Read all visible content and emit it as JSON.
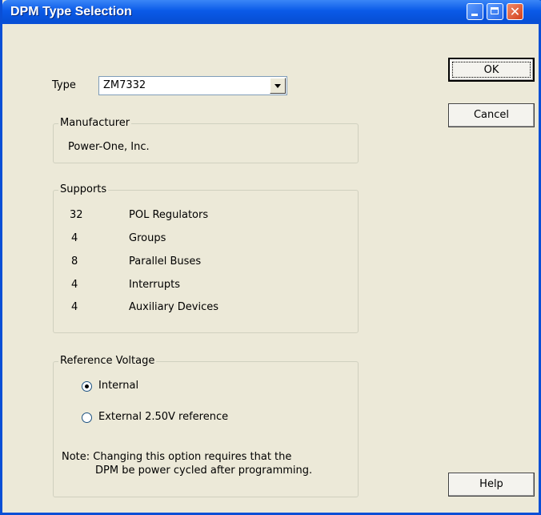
{
  "window": {
    "title": "DPM Type Selection"
  },
  "type_field": {
    "label": "Type",
    "value": "ZM7332"
  },
  "manufacturer": {
    "title": "Manufacturer",
    "name": "Power-One, Inc."
  },
  "supports": {
    "title": "Supports",
    "items": [
      {
        "count": "32",
        "label": "POL Regulators"
      },
      {
        "count": "4",
        "label": "Groups"
      },
      {
        "count": "8",
        "label": "Parallel Buses"
      },
      {
        "count": "4",
        "label": "Interrupts"
      },
      {
        "count": "4",
        "label": "Auxiliary Devices"
      }
    ]
  },
  "reference_voltage": {
    "title": "Reference Voltage",
    "options": [
      {
        "label": "Internal",
        "selected": true
      },
      {
        "label": "External 2.50V reference",
        "selected": false
      }
    ],
    "note_line1": "Note: Changing this option requires that the",
    "note_line2": "DPM be power cycled after programming."
  },
  "buttons": {
    "ok": "OK",
    "cancel": "Cancel",
    "help": "Help"
  }
}
